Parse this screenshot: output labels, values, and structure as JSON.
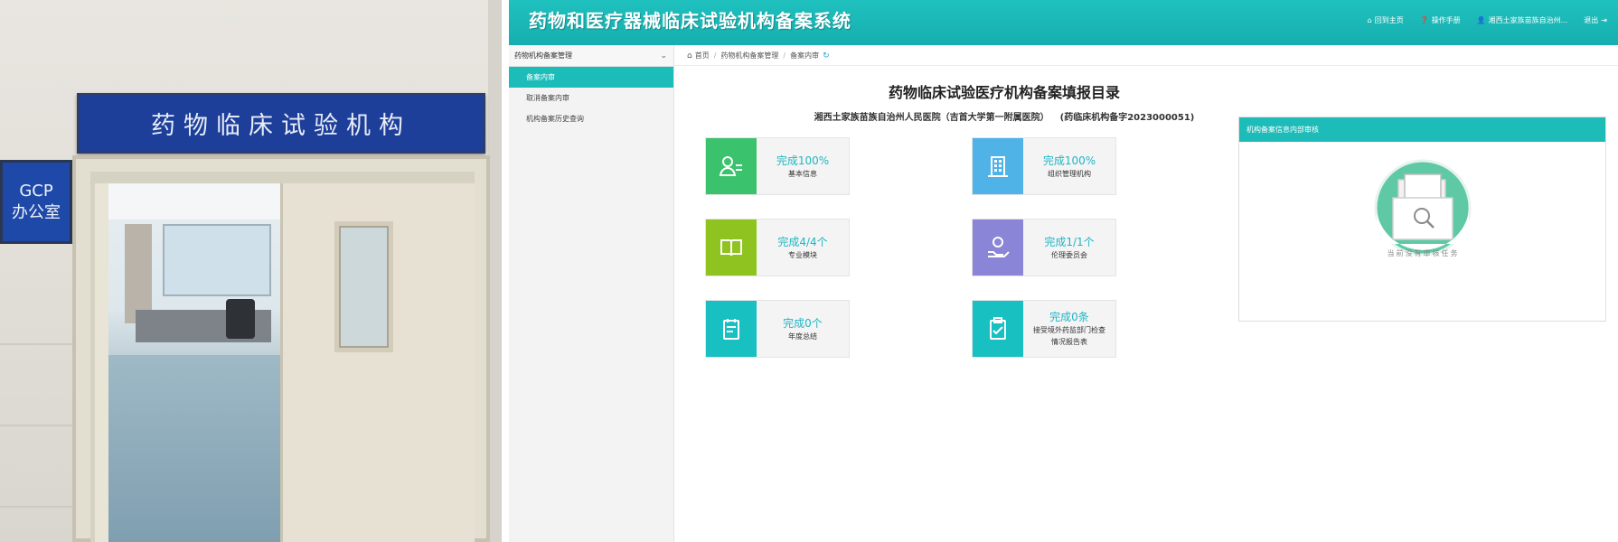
{
  "photo": {
    "main_sign": "药物临床试验机构",
    "gcp_sign_line1": "GCP",
    "gcp_sign_line2": "办公室"
  },
  "header": {
    "title": "药物和医疗器械临床试验机构备案系统",
    "nav": [
      {
        "label": "回到主页",
        "icon": "home-icon"
      },
      {
        "label": "操作手册",
        "icon": "help-icon"
      },
      {
        "label": "湘西土家族苗族自治州...",
        "icon": "user-icon"
      },
      {
        "label": "退出",
        "icon": "logout-icon"
      }
    ],
    "colors": {
      "accent": "#1dbcb9"
    }
  },
  "sidebar": {
    "group": "药物机构备案管理",
    "items": [
      {
        "label": "备案内审",
        "active": true
      },
      {
        "label": "取消备案内审",
        "active": false
      },
      {
        "label": "机构备案历史查询",
        "active": false
      }
    ]
  },
  "breadcrumb": [
    "首页",
    "药物机构备案管理",
    "备案内审"
  ],
  "main": {
    "title": "药物临床试验医疗机构备案填报目录",
    "hospital": "湘西土家族苗族自治州人民医院（吉首大学第一附属医院）",
    "registration": "(药临床机构备字2023000051)"
  },
  "cards": [
    {
      "status": "完成100%",
      "label": "基本信息",
      "icon": "user-card-icon",
      "color": "#3bc26d"
    },
    {
      "status": "完成100%",
      "label": "组织管理机构",
      "icon": "building-icon",
      "color": "#4fb3e8"
    },
    {
      "status": "完成4/4个",
      "label": "专业模块",
      "icon": "book-icon",
      "color": "#8fc31f"
    },
    {
      "status": "完成1/1个",
      "label": "伦理委员会",
      "icon": "person-hand-icon",
      "color": "#8a85d6"
    },
    {
      "status": "完成0个",
      "label": "年度总结",
      "icon": "notepad-icon",
      "color": "#18c0c2"
    },
    {
      "status": "完成0条",
      "label": "接受境外药监部门检查情况报告表",
      "icon": "clipboard-icon",
      "color": "#18c0c2"
    }
  ],
  "review": {
    "title": "机构备案信息内部审核",
    "empty": "当前没有审核任务"
  }
}
